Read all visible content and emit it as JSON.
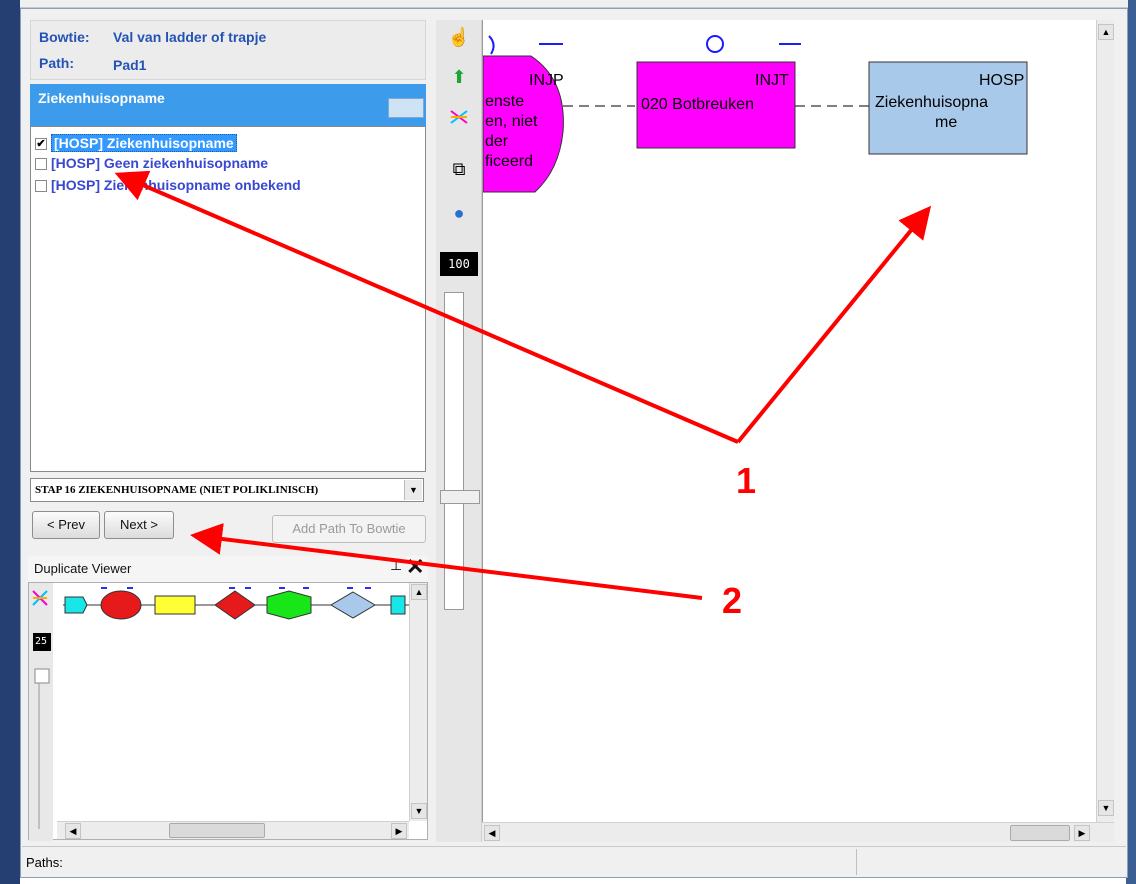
{
  "header": {
    "bowtie_label": "Bowtie:",
    "bowtie_value": "Val van ladder of trapje",
    "path_label": "Path:",
    "path_value": "Pad1"
  },
  "panel": {
    "title": "Ziekenhuisopname"
  },
  "options": [
    {
      "label": "[HOSP] Ziekenhuisopname",
      "checked": true,
      "selected": true
    },
    {
      "label": "[HOSP] Geen ziekenhuisopname",
      "checked": false,
      "selected": false
    },
    {
      "label": "[HOSP] Ziekenhuisopname onbekend",
      "checked": false,
      "selected": false
    }
  ],
  "step_select": {
    "value": "STAP 16 ZIEKENHUISOPNAME (NIET POLIKLINISCH)"
  },
  "nav": {
    "prev_label": "< Prev",
    "next_label": "Next >",
    "add_path_label": "Add Path To Bowtie"
  },
  "duplicate_viewer": {
    "title": "Duplicate Viewer",
    "pin_icon": "pin-icon",
    "close_icon": "close-icon",
    "zoom": "25"
  },
  "toolbar": {
    "zoom": "100",
    "icons": [
      "hand-icon",
      "arrow-up-icon",
      "shuffle-icon",
      "copy-icon",
      "help-icon"
    ]
  },
  "diagram": {
    "nodes": [
      {
        "code": "INJP",
        "lines": [
          "enste",
          "en, niet",
          "der",
          "ficeerd"
        ],
        "color": "#ff00ff"
      },
      {
        "code": "INJT",
        "lines": [
          "020 Botbreuken"
        ],
        "color": "#ff00ff"
      },
      {
        "code": "HOSP",
        "lines": [
          "Ziekenhuisopna",
          "me"
        ],
        "color": "#a9c9ea"
      }
    ]
  },
  "annotations": {
    "label_1": "1",
    "label_2": "2",
    "color": "#ff0000"
  },
  "status": {
    "text": "Paths:"
  }
}
